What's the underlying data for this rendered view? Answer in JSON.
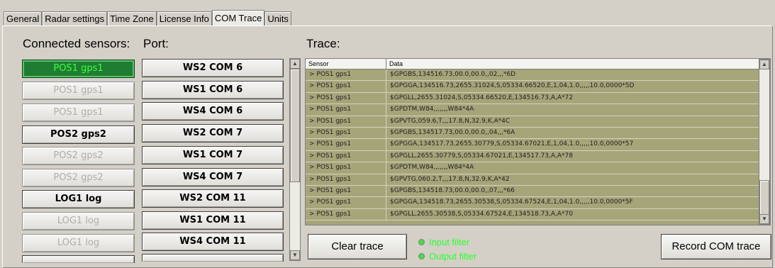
{
  "tabs": [
    {
      "label": "General",
      "active": false
    },
    {
      "label": "Radar settings",
      "active": false
    },
    {
      "label": "Time Zone",
      "active": false
    },
    {
      "label": "License Info",
      "active": false
    },
    {
      "label": "COM Trace",
      "active": true
    },
    {
      "label": "Units",
      "active": false
    }
  ],
  "headers": {
    "sensors": "Connected sensors:",
    "port": "Port:",
    "trace": "Trace:"
  },
  "sensors": [
    {
      "label": "POS1 gps1",
      "state": "active"
    },
    {
      "label": "POS1 gps1",
      "state": "disabled"
    },
    {
      "label": "POS1 gps1",
      "state": "disabled"
    },
    {
      "label": "POS2 gps2",
      "state": "normal"
    },
    {
      "label": "POS2 gps2",
      "state": "disabled"
    },
    {
      "label": "POS2 gps2",
      "state": "disabled"
    },
    {
      "label": "LOG1 log",
      "state": "normal"
    },
    {
      "label": "LOG1 log",
      "state": "disabled"
    },
    {
      "label": "LOG1 log",
      "state": "disabled"
    }
  ],
  "ports": [
    "WS2 COM 6",
    "WS1 COM 6",
    "WS4 COM 6",
    "WS2 COM 7",
    "WS1 COM 7",
    "WS4 COM 7",
    "WS2 COM 11",
    "WS1 COM 11",
    "WS4 COM 11"
  ],
  "trace_table": {
    "columns": [
      "Sensor",
      "Data"
    ],
    "rows": [
      [
        "> POS1 gps1",
        "$GPGBS,134516.73,00.0,00.0,,02,,,*6D"
      ],
      [
        "> POS1 gps1",
        "$GPGGA,134516.73,2655.31024,S,05334.66520,E,1,04,1.0,,,,,10.0,0000*5D"
      ],
      [
        "> POS1 gps1",
        "$GPGLL,2655.31024,S,05334.66520,E,134516.73,A,A*72"
      ],
      [
        "> POS1 gps1",
        "$GPDTM,W84,,,,,,,W84*4A"
      ],
      [
        "> POS1 gps1",
        "$GPVTG,059.6,T,,,17.8,N,32.9,K,A*4C"
      ],
      [
        "> POS1 gps1",
        "$GPGBS,134517.73,00.0,00.0,,04,,,*6A"
      ],
      [
        "> POS1 gps1",
        "$GPGGA,134517.73,2655.30779,S,05334.67021,E,1,04,1.0,,,,,10.0,0000*57"
      ],
      [
        "> POS1 gps1",
        "$GPGLL,2655.30779,S,05334.67021,E,134517.73,A,A*78"
      ],
      [
        "> POS1 gps1",
        "$GPDTM,W84,,,,,,,W84*4A"
      ],
      [
        "> POS1 gps1",
        "$GPVTG,060.2,T,,,17.8,N,32.9,K,A*42"
      ],
      [
        "> POS1 gps1",
        "$GPGBS,134518.73,00.0,00.0,,07,,,*66"
      ],
      [
        "> POS1 gps1",
        "$GPGGA,134518.73,2655.30538,S,05334.67524,E,1,04,1.0,,,,,10.0,0000*5F"
      ],
      [
        "> POS1 gps1",
        "$GPGLL,2655.30538,S,05334.67524,E,134518.73,A,A*70"
      ]
    ]
  },
  "buttons": {
    "clear_trace": "Clear trace",
    "record_com_trace": "Record COM trace"
  },
  "filters": {
    "input": "Input filter",
    "output": "Output filter"
  },
  "colors": {
    "active_sensor_bg": "#1f7d33",
    "active_sensor_text": "#3bff3b",
    "trace_bg": "#a6a57a",
    "filter_text": "#2bff2b"
  }
}
